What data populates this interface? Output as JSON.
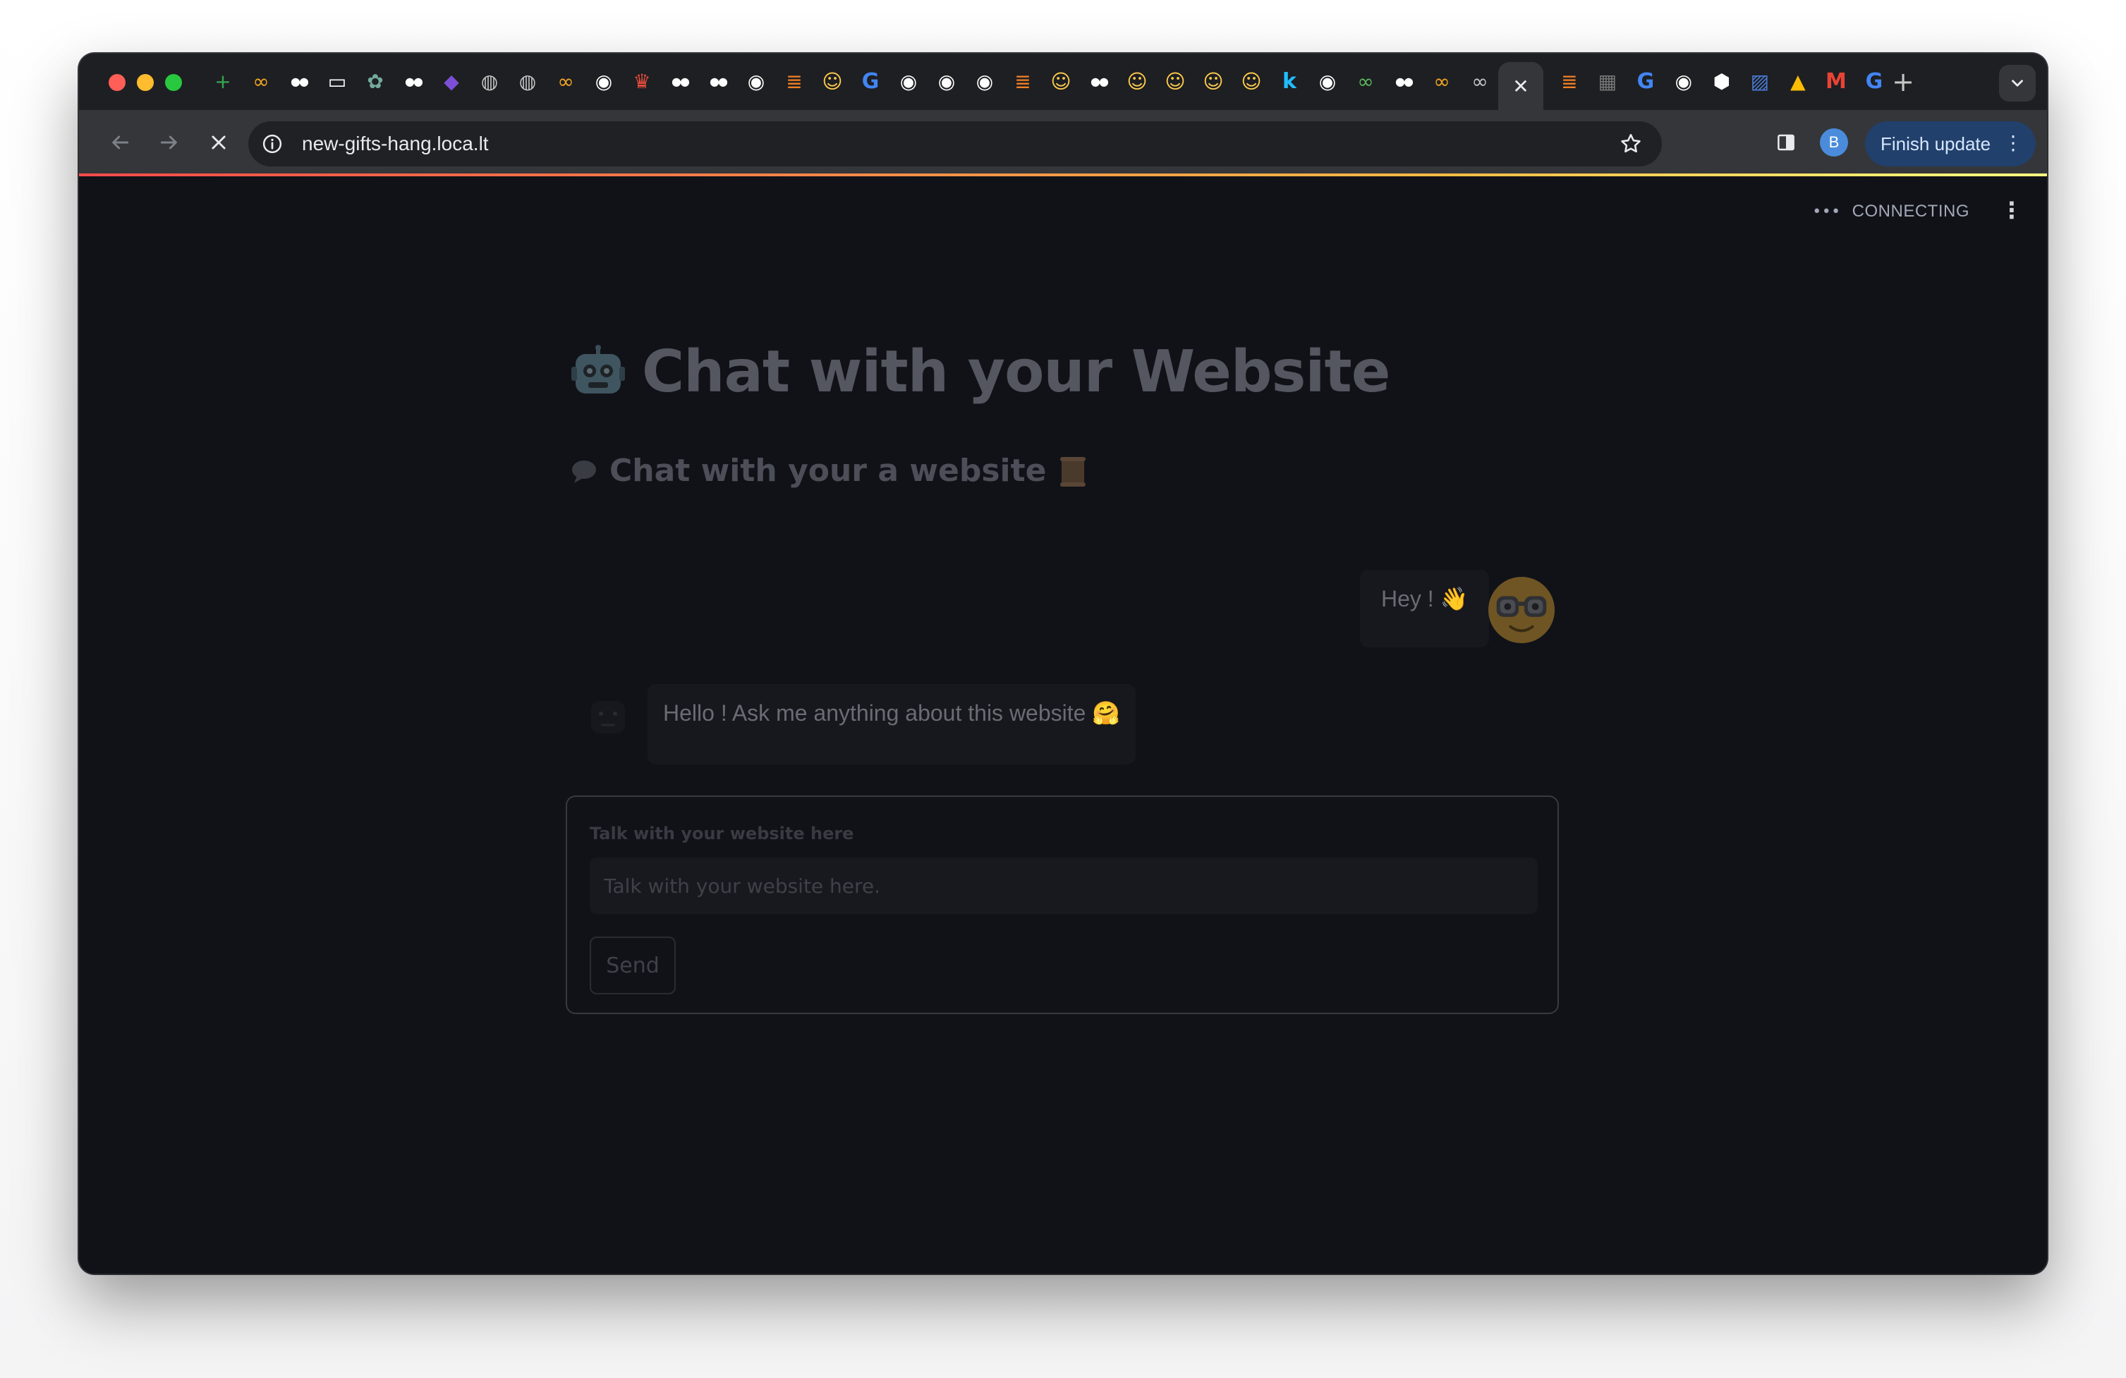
{
  "browser": {
    "url": "new-gifts-hang.loca.lt",
    "finish_update_label": "Finish update",
    "profile_initial": "B",
    "close_tab_glyph": "✕",
    "new_tab_glyph": "+",
    "tab_favicons": [
      {
        "icon": "sheets-icon",
        "glyph": "+",
        "color": "#34a853"
      },
      {
        "icon": "infinity-icon",
        "glyph": "∞",
        "color": "#f5a623"
      },
      {
        "icon": "medium-icon",
        "glyph": "●●",
        "color": "#ffffff"
      },
      {
        "icon": "vr-icon",
        "glyph": "▭",
        "color": "#ffffff"
      },
      {
        "icon": "openai-icon",
        "glyph": "✿",
        "color": "#74aa9c"
      },
      {
        "icon": "medium-icon",
        "glyph": "●●",
        "color": "#ffffff"
      },
      {
        "icon": "cube-icon",
        "glyph": "◆",
        "color": "#7b4fd6"
      },
      {
        "icon": "globe-icon",
        "glyph": "◍",
        "color": "#c4c7c5"
      },
      {
        "icon": "globe-icon",
        "glyph": "◍",
        "color": "#c4c7c5"
      },
      {
        "icon": "infinity-icon",
        "glyph": "∞",
        "color": "#f5a623"
      },
      {
        "icon": "github-icon",
        "glyph": "◉",
        "color": "#ffffff"
      },
      {
        "icon": "crown-icon",
        "glyph": "♛",
        "color": "#e74c3c"
      },
      {
        "icon": "medium-icon",
        "glyph": "●●",
        "color": "#ffffff"
      },
      {
        "icon": "medium-icon",
        "glyph": "●●",
        "color": "#ffffff"
      },
      {
        "icon": "github-icon",
        "glyph": "◉",
        "color": "#ffffff"
      },
      {
        "icon": "stackoverflow-icon",
        "glyph": "≣",
        "color": "#f48024"
      },
      {
        "icon": "huggingface-icon",
        "glyph": "☺",
        "color": "#ffcc4d"
      },
      {
        "icon": "google-icon",
        "glyph": "G",
        "color": "#4285f4"
      },
      {
        "icon": "github-icon",
        "glyph": "◉",
        "color": "#ffffff"
      },
      {
        "icon": "github-icon",
        "glyph": "◉",
        "color": "#ffffff"
      },
      {
        "icon": "github-icon",
        "glyph": "◉",
        "color": "#ffffff"
      },
      {
        "icon": "stackoverflow-icon",
        "glyph": "≣",
        "color": "#f48024"
      },
      {
        "icon": "huggingface-icon",
        "glyph": "☺",
        "color": "#ffcc4d"
      },
      {
        "icon": "medium-icon",
        "glyph": "●●",
        "color": "#ffffff"
      },
      {
        "icon": "huggingface-icon",
        "glyph": "☺",
        "color": "#ffcc4d"
      },
      {
        "icon": "huggingface-icon",
        "glyph": "☺",
        "color": "#ffcc4d"
      },
      {
        "icon": "huggingface-icon",
        "glyph": "☺",
        "color": "#ffcc4d"
      },
      {
        "icon": "huggingface-icon",
        "glyph": "☺",
        "color": "#ffcc4d"
      },
      {
        "icon": "k-icon",
        "glyph": "k",
        "color": "#20beff"
      },
      {
        "icon": "github-icon",
        "glyph": "◉",
        "color": "#ffffff"
      },
      {
        "icon": "link-icon",
        "glyph": "∞",
        "color": "#5cb85c"
      },
      {
        "icon": "medium-icon",
        "glyph": "●●",
        "color": "#ffffff"
      },
      {
        "icon": "infinity-icon",
        "glyph": "∞",
        "color": "#f5a623"
      },
      {
        "icon": "infinity-icon",
        "glyph": "∞",
        "color": "#c4c7c5"
      },
      {
        "icon": "stackoverflow-icon",
        "glyph": "≣",
        "color": "#f48024"
      },
      {
        "icon": "grid-icon",
        "glyph": "▦",
        "color": "#777777"
      },
      {
        "icon": "google-icon",
        "glyph": "G",
        "color": "#4285f4"
      },
      {
        "icon": "github-icon",
        "glyph": "◉",
        "color": "#ffffff"
      },
      {
        "icon": "hexagon-icon",
        "glyph": "⬢",
        "color": "#ffffff"
      },
      {
        "icon": "slides-icon",
        "glyph": "▨",
        "color": "#4a7bd6"
      },
      {
        "icon": "drive-icon",
        "glyph": "▲",
        "color": "#fbbc04"
      },
      {
        "icon": "gmail-icon",
        "glyph": "M",
        "color": "#ea4335"
      },
      {
        "icon": "google-icon",
        "glyph": "G",
        "color": "#4285f4"
      }
    ]
  },
  "app": {
    "status": "CONNECTING",
    "title": "Chat with your Website",
    "subtitle": "Chat with your a website",
    "messages": [
      {
        "role": "user",
        "text": "Hey ! 👋"
      },
      {
        "role": "assistant",
        "text": "Hello ! Ask me anything about this website 🤗"
      }
    ],
    "form": {
      "label": "Talk with your website here",
      "placeholder": "Talk with your website here.",
      "send_label": "Send"
    }
  }
}
